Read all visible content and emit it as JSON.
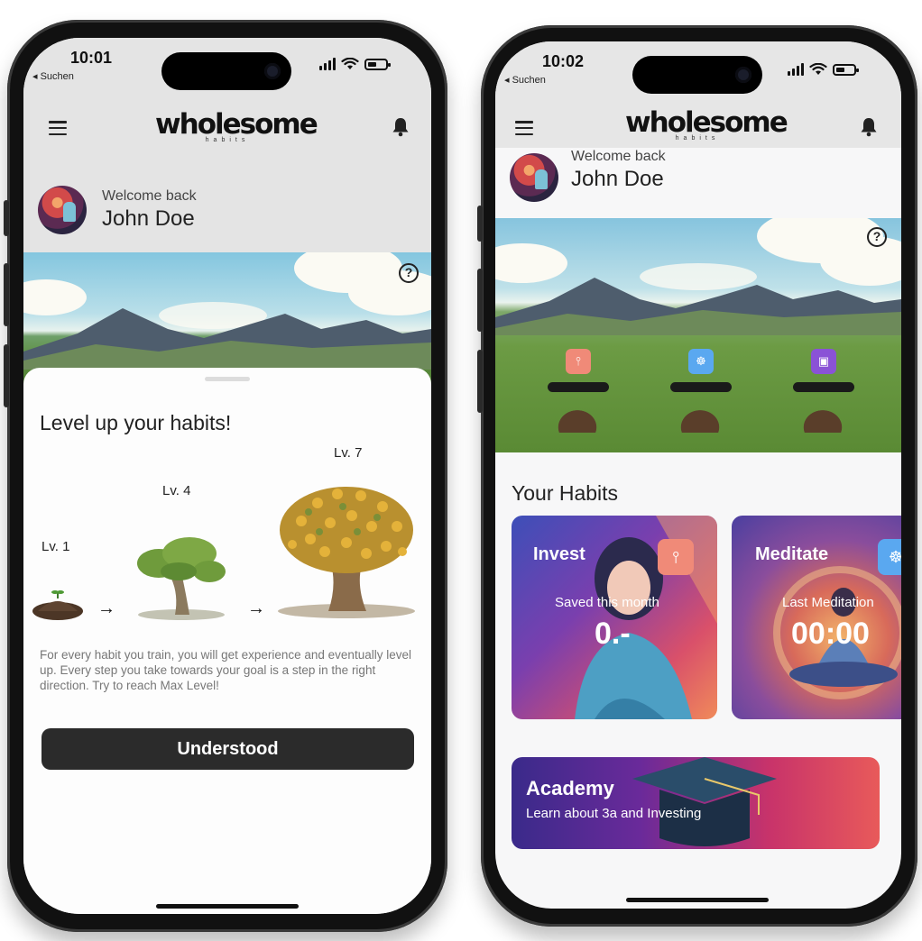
{
  "left_phone": {
    "status": {
      "time": "10:01",
      "back_label": "◂ Suchen"
    },
    "app_bar": {
      "logo": "wholesome",
      "logo_sub": "habits"
    },
    "welcome": {
      "greeting": "Welcome back",
      "name": "John Doe"
    },
    "sheet": {
      "title": "Level up your habits!",
      "levels": [
        "Lv. 1",
        "Lv. 4",
        "Lv. 7"
      ],
      "arrow": "→",
      "description": "For every habit you train, you will get experience and eventually level up. Every step you take towards your goal is a step in the right direction. Try to reach Max Level!",
      "button_label": "Understood"
    }
  },
  "right_phone": {
    "status": {
      "time": "10:02",
      "back_label": "◂ Suchen"
    },
    "app_bar": {
      "logo": "wholesome",
      "logo_sub": "habits"
    },
    "welcome": {
      "greeting": "Welcome back",
      "name": "John Doe"
    },
    "section_title": "Your Habits",
    "habit_icons": [
      {
        "icon": "invest-icon",
        "color": "#f08a78"
      },
      {
        "icon": "meditate-icon",
        "color": "#5aa8f0"
      },
      {
        "icon": "habit-icon",
        "color": "#8a52d6"
      }
    ],
    "cards": [
      {
        "title": "Invest",
        "label": "Saved this month",
        "value": "0.-",
        "icon": "invest-icon"
      },
      {
        "title": "Meditate",
        "label": "Last Meditation",
        "value": "00:00",
        "icon": "meditate-icon"
      }
    ],
    "academy": {
      "title": "Academy",
      "subtitle": "Learn about 3a and Investing"
    }
  },
  "colors": {
    "dark_button": "#2b2b2b",
    "invest_chip": "#f08a78",
    "meditate_chip": "#5aa8f0",
    "tracker_chip": "#8a52d6"
  }
}
